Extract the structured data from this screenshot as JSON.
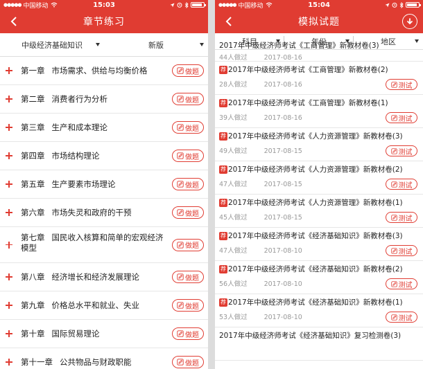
{
  "left": {
    "status": {
      "carrier": "中国移动",
      "time": "15:03"
    },
    "nav": {
      "title": "章节练习"
    },
    "filters": [
      {
        "label": "中级经济基础知识"
      },
      {
        "label": "新版"
      }
    ],
    "practice_label": "做题",
    "chapters": [
      {
        "num": "第一章",
        "name": "市场需求、供给与均衡价格"
      },
      {
        "num": "第二章",
        "name": "消费者行为分析"
      },
      {
        "num": "第三章",
        "name": "生产和成本理论"
      },
      {
        "num": "第四章",
        "name": "市场结构理论"
      },
      {
        "num": "第五章",
        "name": "生产要素市场理论"
      },
      {
        "num": "第六章",
        "name": "市场失灵和政府的干预"
      },
      {
        "num": "第七章",
        "name": "国民收入核算和简单的宏观经济模型"
      },
      {
        "num": "第八章",
        "name": "经济增长和经济发展理论"
      },
      {
        "num": "第九章",
        "name": "价格总水平和就业、失业"
      },
      {
        "num": "第十章",
        "name": "国际贸易理论"
      },
      {
        "num": "第十一章",
        "name": "公共物品与财政职能"
      }
    ]
  },
  "right": {
    "status": {
      "carrier": "中国移动",
      "time": "15:04"
    },
    "nav": {
      "title": "模拟试题"
    },
    "filters": [
      {
        "label": "科目"
      },
      {
        "label": "年份"
      },
      {
        "label": "地区"
      }
    ],
    "rec_tag": "荐",
    "test_label": "测试",
    "papers": [
      {
        "title": "2017年中级经济师考试《工商管理》新教材卷(3)",
        "count": "44人做过",
        "date": "2017-08-16",
        "rec": false
      },
      {
        "title": "2017年中级经济师考试《工商管理》新教材卷(2)",
        "count": "28人做过",
        "date": "2017-08-16",
        "rec": true
      },
      {
        "title": "2017年中级经济师考试《工商管理》新教材卷(1)",
        "count": "39人做过",
        "date": "2017-08-16",
        "rec": true
      },
      {
        "title": "2017年中级经济师考试《人力资源管理》新教材卷(3)",
        "count": "49人做过",
        "date": "2017-08-15",
        "rec": true
      },
      {
        "title": "2017年中级经济师考试《人力资源管理》新教材卷(2)",
        "count": "47人做过",
        "date": "2017-08-15",
        "rec": true
      },
      {
        "title": "2017年中级经济师考试《人力资源管理》新教材卷(1)",
        "count": "45人做过",
        "date": "2017-08-15",
        "rec": true
      },
      {
        "title": "2017年中级经济师考试《经济基础知识》新教材卷(3)",
        "count": "47人做过",
        "date": "2017-08-10",
        "rec": true
      },
      {
        "title": "2017年中级经济师考试《经济基础知识》新教材卷(2)",
        "count": "56人做过",
        "date": "2017-08-10",
        "rec": true
      },
      {
        "title": "2017年中级经济师考试《经济基础知识》新教材卷(1)",
        "count": "53人做过",
        "date": "2017-08-10",
        "rec": true
      },
      {
        "title": "2017年中级经济师考试《经济基础知识》复习检测卷(3)",
        "count": "",
        "date": "",
        "rec": false
      }
    ]
  }
}
